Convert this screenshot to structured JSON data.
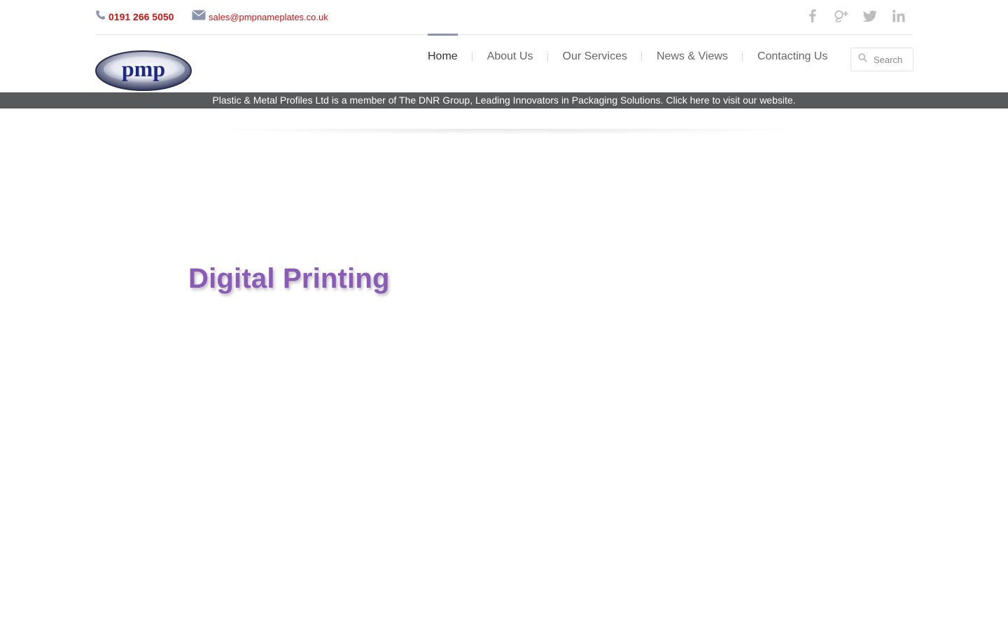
{
  "contact": {
    "phone": "0191 266 5050",
    "email": "sales@pmpnameplates.co.uk"
  },
  "social": [
    {
      "name": "facebook-icon"
    },
    {
      "name": "google-plus-icon"
    },
    {
      "name": "twitter-icon"
    },
    {
      "name": "linkedin-icon"
    }
  ],
  "logo": {
    "text": "pmp"
  },
  "nav": {
    "home": "Home",
    "about": "About Us",
    "services": "Our Services",
    "news": "News & Views",
    "contact": "Contacting Us"
  },
  "search": {
    "placeholder": "Search"
  },
  "banner": {
    "text": "Plastic & Metal Profiles Ltd is a member of The DNR Group, Leading Innovators in Packaging Solutions. Click here to visit our website."
  },
  "hero": {
    "title": "Digital Printing"
  },
  "colors": {
    "accent_red": "#cc1414",
    "hero_purple": "#8a5bb7",
    "banner_bg": "#58595b",
    "nav_active_bar": "#8c93ad"
  }
}
